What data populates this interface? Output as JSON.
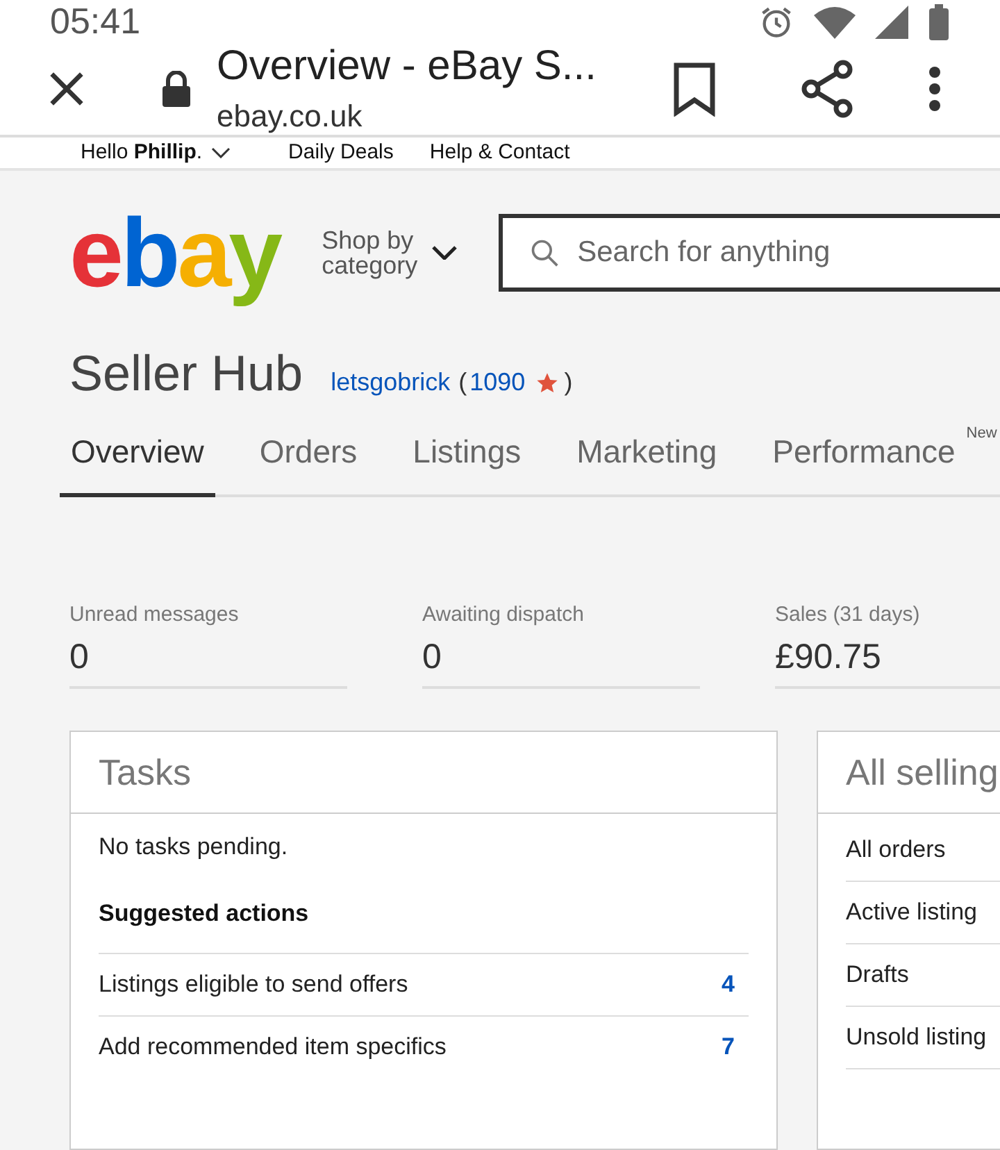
{
  "status_bar": {
    "time": "05:41"
  },
  "browser": {
    "title": "Overview - eBay S...",
    "url": "ebay.co.uk"
  },
  "top_nav": {
    "greeting": "Hello **Phillip**.",
    "links": [
      "Daily Deals",
      "Help & Contact"
    ]
  },
  "header": {
    "logo": "ebay",
    "category": [
      "Shop by",
      "category"
    ],
    "search": {
      "placeholder": "Search for anything"
    }
  },
  "seller": {
    "title": "Seller Hub",
    "user": "letsgobrick",
    "open": "(",
    "score": "1090",
    "close": ")"
  },
  "tabs": [
    {
      "label": "Overview",
      "selected": true
    },
    {
      "label": "Orders",
      "selected": false
    },
    {
      "label": "Listings",
      "selected": false
    },
    {
      "label": "Marketing",
      "selected": false
    },
    {
      "label": "Performance",
      "selected": false,
      "badge": "New"
    }
  ],
  "stats": [
    {
      "label": "Unread messages",
      "value": "0"
    },
    {
      "label": "Awaiting dispatch",
      "value": "0"
    },
    {
      "label": "Sales (31 days)",
      "value": "£90.75"
    }
  ],
  "tasks": {
    "title": "Tasks",
    "empty": "No tasks pending.",
    "suggested": "Suggested actions",
    "actions": [
      {
        "label": "Listings eligible to send offers",
        "count": "4"
      },
      {
        "label": "Add recommended item specifics",
        "count": "7"
      }
    ]
  },
  "all_selling": {
    "title": "All selling",
    "items": [
      "All orders",
      "Active listing",
      "Drafts",
      "Unsold listing"
    ]
  }
}
